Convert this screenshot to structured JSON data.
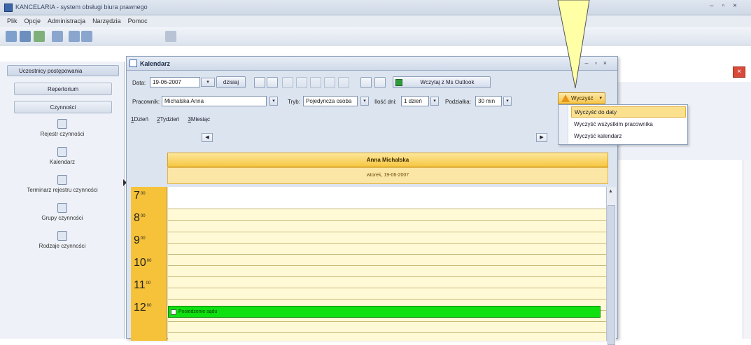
{
  "app": {
    "title": "KANCELARIA - system obsługi biura prawnego",
    "menu": [
      "Plik",
      "Opcje",
      "Administracja",
      "Narzędzia",
      "Pomoc"
    ]
  },
  "left_pane": {
    "header": "Uczestnicy postępowania",
    "buttons": [
      "Repertorium",
      "Czynności"
    ],
    "items": [
      "Rejestr czynności",
      "Kalendarz",
      "Terminarz rejestru czynności",
      "Grupy czynności",
      "Rodzaje czynności"
    ]
  },
  "dialog": {
    "title": "Kalendarz",
    "date_label": "Data:",
    "date_value": "19-06-2007",
    "today_button": "dzisiaj",
    "outlook_button": "Wczytaj z Ms Outlook",
    "clear_button": "Wyczyść",
    "worker_label": "Pracownik:",
    "worker_value": "Michalska Anna",
    "mode_label": "Tryb:",
    "mode_value": "Pojedyncza osoba",
    "days_label": "Ilość dni:",
    "days_value": "1 dzień",
    "scale_label": "Podziałka:",
    "scale_value": "30 min",
    "tabs": [
      {
        "key": "1",
        "rest": "Dzień"
      },
      {
        "key": "2",
        "rest": "Tydzień"
      },
      {
        "key": "3",
        "rest": "Miesiąc"
      }
    ],
    "calendar": {
      "person": "Anna Michalska",
      "date": "wtorek, 19-06-2007",
      "hours": [
        "7",
        "8",
        "9",
        "10",
        "11",
        "12"
      ],
      "minutes": "00",
      "event": "Posiedzenie sądu",
      "event_color": "#10e010",
      "header_color": "#f6c23a"
    }
  },
  "clear_menu": {
    "items": [
      "Wyczyść do daty",
      "Wyczyść wszystkim pracownika",
      "Wyczyść kalendarz"
    ],
    "highlighted": 0
  }
}
